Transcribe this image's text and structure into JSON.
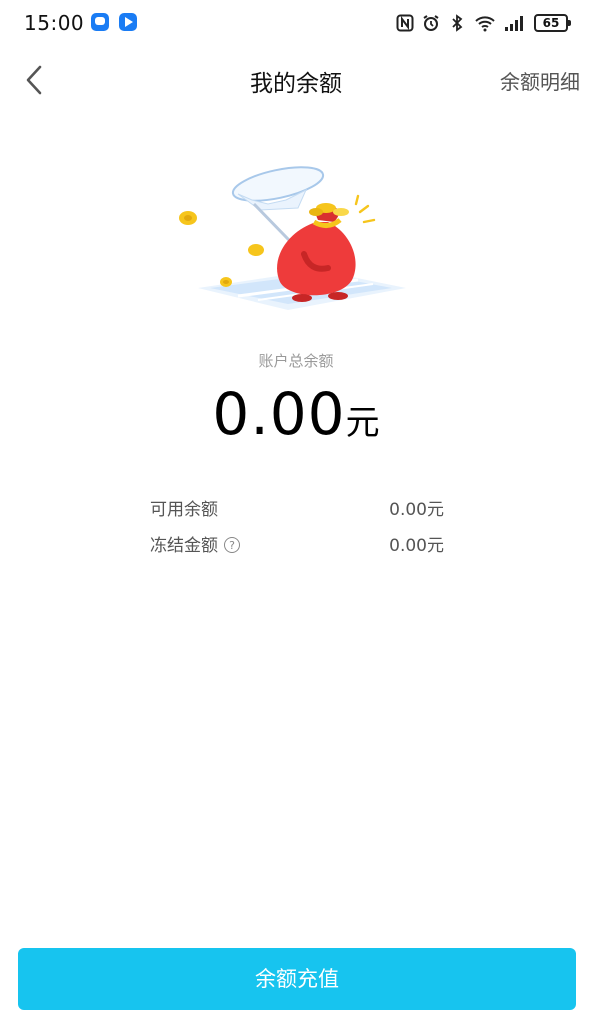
{
  "status_bar": {
    "time": "15:00",
    "battery": "65",
    "icons": [
      "message-icon",
      "video-icon",
      "nfc-icon",
      "alarm-icon",
      "bluetooth-icon",
      "wifi-icon",
      "signal-icon",
      "battery-icon"
    ]
  },
  "nav": {
    "title": "我的余额",
    "detail_link": "余额明细"
  },
  "balance": {
    "total_label": "账户总余额",
    "total_amount": "0.00",
    "unit": "元",
    "available_label": "可用余额",
    "available_value": "0.00元",
    "frozen_label": "冻结金额",
    "frozen_value": "0.00元"
  },
  "footer": {
    "topup_label": "余额充值"
  },
  "colors": {
    "accent": "#17c4ef",
    "bag_red": "#ee3b3b",
    "coin_gold": "#f6c51c"
  }
}
